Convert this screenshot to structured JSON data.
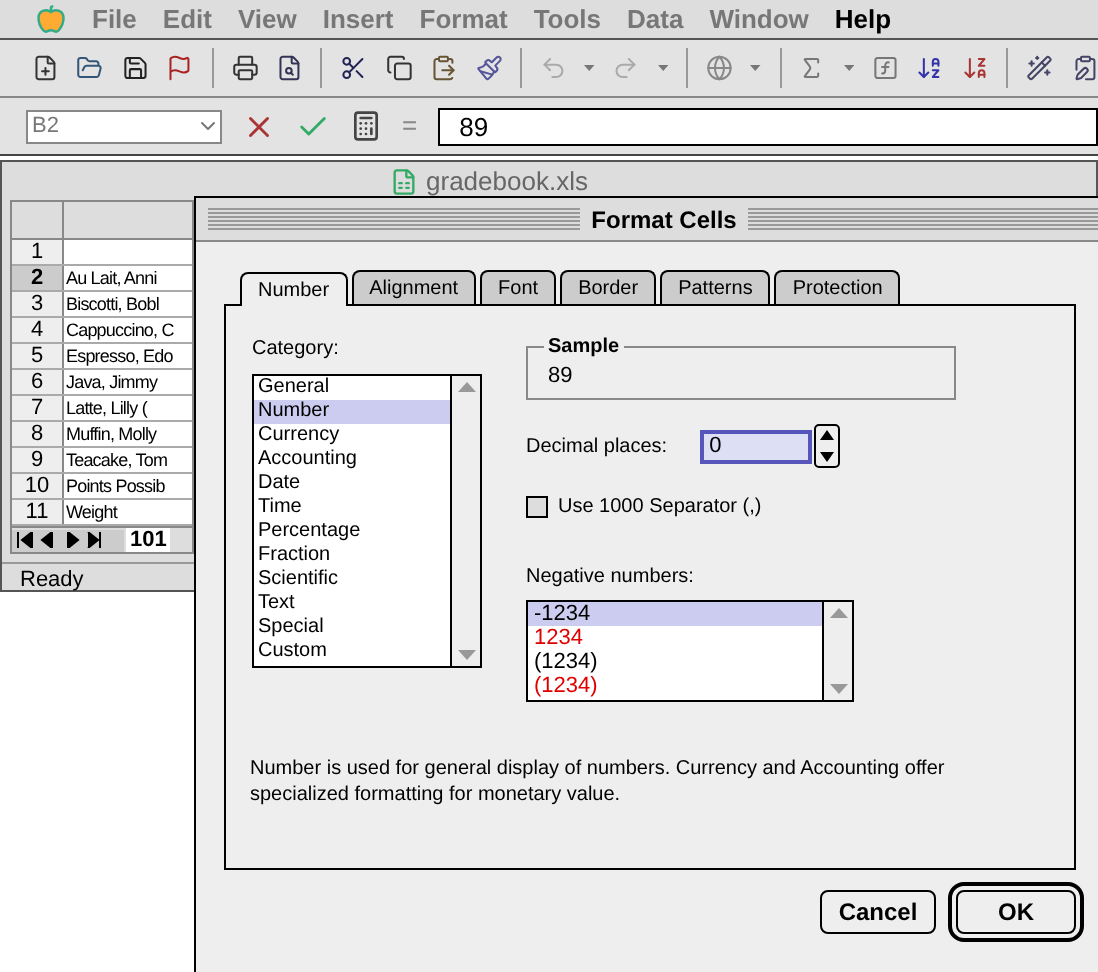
{
  "menu_bar": {
    "items": [
      {
        "label": "File",
        "disabled": true
      },
      {
        "label": "Edit",
        "disabled": true
      },
      {
        "label": "View",
        "disabled": true
      },
      {
        "label": "Insert",
        "disabled": true
      },
      {
        "label": "Format",
        "disabled": true
      },
      {
        "label": "Tools",
        "disabled": true
      },
      {
        "label": "Data",
        "disabled": true
      },
      {
        "label": "Window",
        "disabled": true
      },
      {
        "label": "Help",
        "disabled": false
      }
    ]
  },
  "formula_bar": {
    "name_box": "B2",
    "equals": "=",
    "value": "89"
  },
  "workbook": {
    "title": "gradebook.xls",
    "rows": [
      {
        "number": "1",
        "selected": false
      },
      {
        "number": "2",
        "cell": "Au Lait, Anni",
        "selected": true
      },
      {
        "number": "3",
        "cell": "Biscotti, Bobl",
        "selected": false
      },
      {
        "number": "4",
        "cell": "Cappuccino, C",
        "selected": false
      },
      {
        "number": "5",
        "cell": "Espresso, Edo",
        "selected": false
      },
      {
        "number": "6",
        "cell": "Java, Jimmy",
        "selected": false
      },
      {
        "number": "7",
        "cell": "Latte, Lilly (",
        "selected": false
      },
      {
        "number": "8",
        "cell": "Muffin, Molly",
        "selected": false
      },
      {
        "number": "9",
        "cell": "Teacake, Tom",
        "selected": false
      },
      {
        "number": "10",
        "cell": "Points Possib",
        "selected": false
      },
      {
        "number": "11",
        "cell": "Weight",
        "selected": false
      }
    ],
    "sheet_tab": "101",
    "status": "Ready"
  },
  "dialog": {
    "title": "Format Cells",
    "tabs": [
      {
        "label": "Number",
        "selected": true
      },
      {
        "label": "Alignment",
        "selected": false
      },
      {
        "label": "Font",
        "selected": false
      },
      {
        "label": "Border",
        "selected": false
      },
      {
        "label": "Patterns",
        "selected": false
      },
      {
        "label": "Protection",
        "selected": false
      }
    ],
    "category_label": "Category:",
    "categories": [
      {
        "label": "General",
        "selected": false
      },
      {
        "label": "Number",
        "selected": true
      },
      {
        "label": "Currency",
        "selected": false
      },
      {
        "label": "Accounting",
        "selected": false
      },
      {
        "label": "Date",
        "selected": false
      },
      {
        "label": "Time",
        "selected": false
      },
      {
        "label": "Percentage",
        "selected": false
      },
      {
        "label": "Fraction",
        "selected": false
      },
      {
        "label": "Scientific",
        "selected": false
      },
      {
        "label": "Text",
        "selected": false
      },
      {
        "label": "Special",
        "selected": false
      },
      {
        "label": "Custom",
        "selected": false
      }
    ],
    "sample_label": "Sample",
    "sample_value": "89",
    "decimal_label": "Decimal places:",
    "decimal_value": "0",
    "separator": {
      "label": "Use 1000 Separator (,)",
      "checked": false
    },
    "negative_label": "Negative numbers:",
    "negative_formats": [
      {
        "label": "-1234",
        "color": "#000000",
        "selected": true
      },
      {
        "label": "1234",
        "color": "#e00000",
        "selected": false
      },
      {
        "label": "(1234)",
        "color": "#000000",
        "selected": false
      },
      {
        "label": "(1234)",
        "color": "#e00000",
        "selected": false
      }
    ],
    "description": "Number is used for general display of numbers.  Currency and Accounting offer specialized formatting for monetary value.",
    "buttons": [
      {
        "label": "Cancel",
        "default": false
      },
      {
        "label": "OK",
        "default": true
      }
    ]
  }
}
